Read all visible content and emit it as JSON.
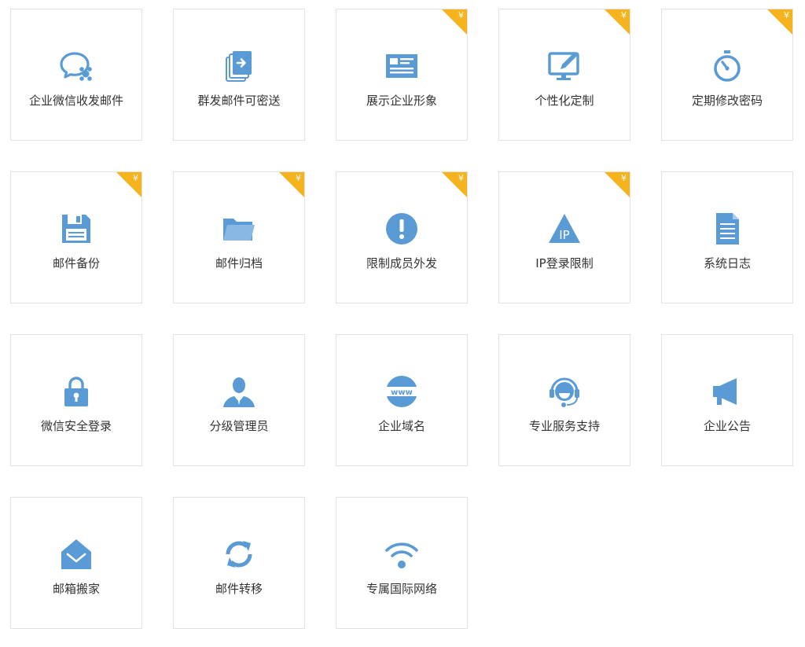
{
  "colors": {
    "icon": "#5b9bd5",
    "badge": "#f5b31e",
    "border": "#e2e2e2",
    "text": "#333333"
  },
  "badge_symbol": "¥",
  "cards": [
    {
      "label": "企业微信收发邮件",
      "icon": "chat-bubbles-icon",
      "premium": false
    },
    {
      "label": "群发邮件可密送",
      "icon": "forward-documents-icon",
      "premium": false
    },
    {
      "label": "展示企业形象",
      "icon": "business-card-icon",
      "premium": true
    },
    {
      "label": "个性化定制",
      "icon": "monitor-pen-icon",
      "premium": true
    },
    {
      "label": "定期修改密码",
      "icon": "stopwatch-icon",
      "premium": true
    },
    {
      "label": "邮件备份",
      "icon": "floppy-disk-icon",
      "premium": true
    },
    {
      "label": "邮件归档",
      "icon": "folder-icon",
      "premium": true
    },
    {
      "label": "限制成员外发",
      "icon": "exclamation-icon",
      "premium": true
    },
    {
      "label": "IP登录限制",
      "icon": "ip-warning-icon",
      "premium": true
    },
    {
      "label": "系统日志",
      "icon": "document-icon",
      "premium": false
    },
    {
      "label": "微信安全登录",
      "icon": "lock-icon",
      "premium": false
    },
    {
      "label": "分级管理员",
      "icon": "user-icon",
      "premium": false
    },
    {
      "label": "企业域名",
      "icon": "www-globe-icon",
      "premium": false
    },
    {
      "label": "专业服务支持",
      "icon": "headset-icon",
      "premium": false
    },
    {
      "label": "企业公告",
      "icon": "megaphone-icon",
      "premium": false
    },
    {
      "label": "邮箱搬家",
      "icon": "house-mail-icon",
      "premium": false
    },
    {
      "label": "邮件转移",
      "icon": "sync-arrows-icon",
      "premium": false
    },
    {
      "label": "专属国际网络",
      "icon": "wifi-icon",
      "premium": false
    }
  ]
}
